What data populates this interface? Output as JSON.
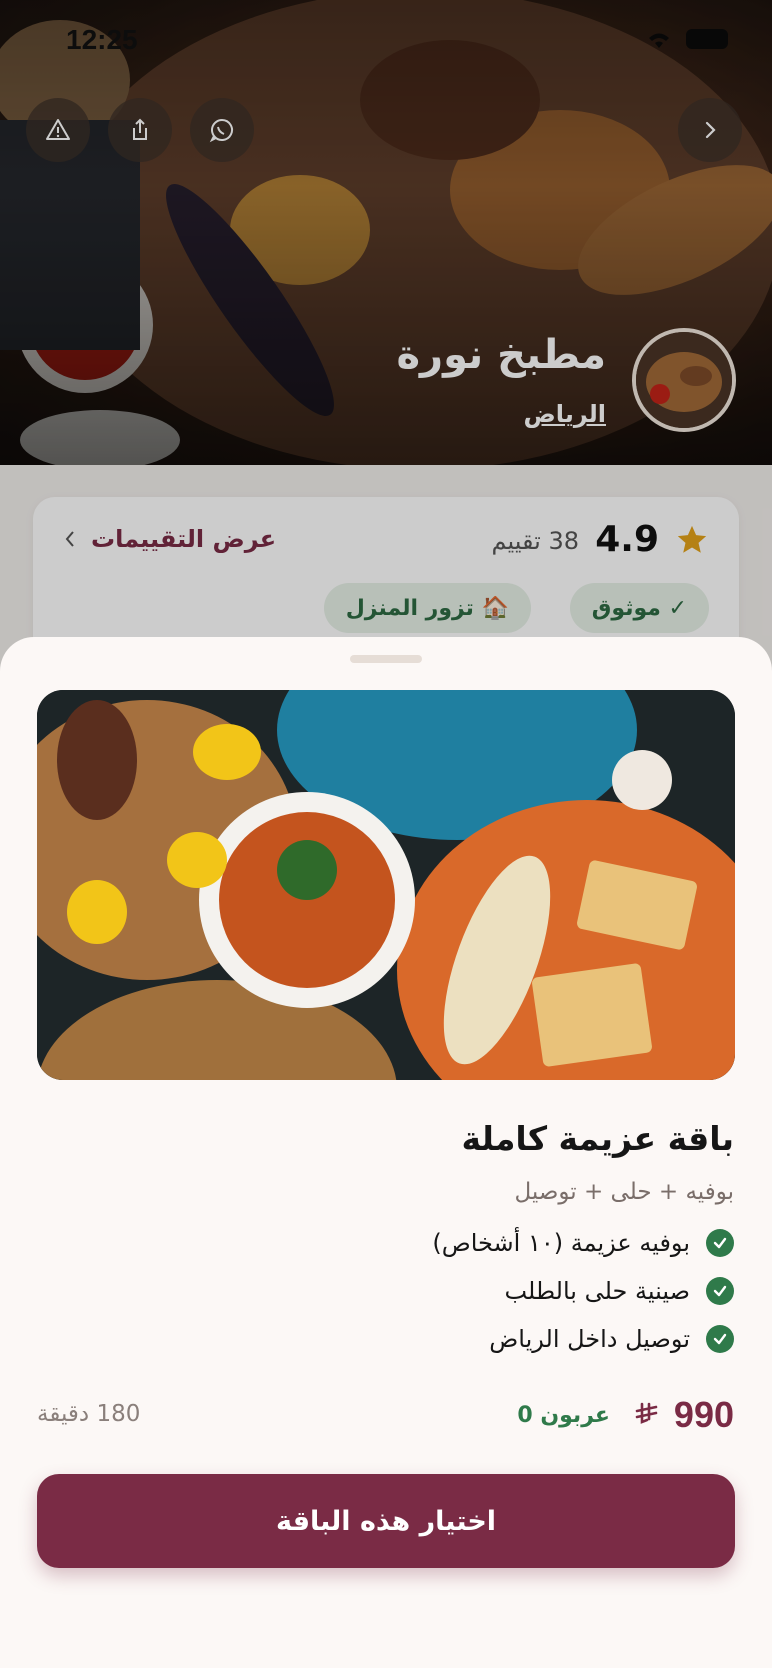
{
  "status_bar": {
    "time": "12:25"
  },
  "hero": {
    "chef_name": "مطبخ نورة",
    "city": "الرياض",
    "actions": [
      "back-icon",
      "whatsapp-icon",
      "share-icon",
      "report-icon"
    ]
  },
  "rating": {
    "value": "4.9",
    "count_text": "38 تقييم",
    "reviews_link": "عرض التقييمات"
  },
  "badges": {
    "verified": "✓ موثوق",
    "home_visit": "🏠 تزور المنزل"
  },
  "package": {
    "title": "باقة عزيمة كاملة",
    "subtitle": "بوفيه + حلى + توصيل",
    "features": [
      {
        "label": "بوفيه عزيمة (١٠ أشخاص)"
      },
      {
        "label": "صينية حلى بالطلب"
      },
      {
        "label": "توصيل داخل الرياض"
      }
    ],
    "price": "990",
    "deposit_text": "عربون 0",
    "duration": "180 دقيقة",
    "cta_label": "اختيار هذه الباقة"
  },
  "colors": {
    "brand": "#7a2b45",
    "success": "#2f7a4a",
    "star": "#e3a21a"
  }
}
